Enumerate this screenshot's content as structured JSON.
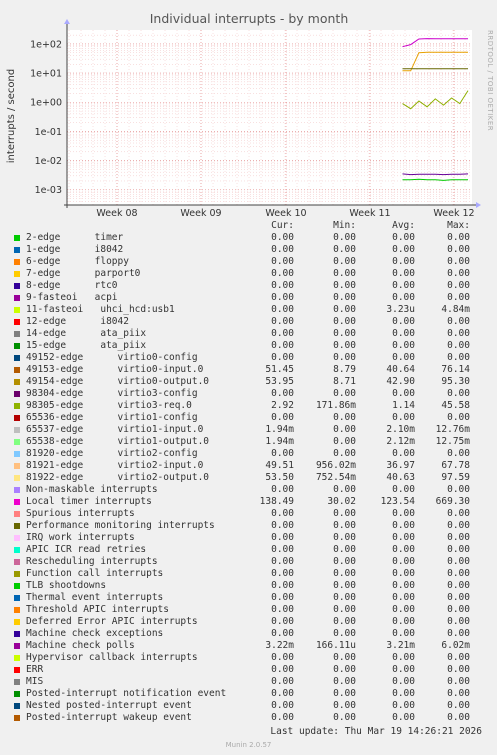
{
  "chart_data": {
    "type": "line",
    "title": "Individual interrupts - by month",
    "ylabel": "interrupts / second",
    "yscale": "log",
    "ylim": [
      0.0003,
      300
    ],
    "yticks": [
      {
        "value": 100,
        "label": "1e+02"
      },
      {
        "value": 10,
        "label": "1e+01"
      },
      {
        "value": 1,
        "label": "1e+00"
      },
      {
        "value": 0.1,
        "label": "1e-01"
      },
      {
        "value": 0.01,
        "label": "1e-02"
      },
      {
        "value": 0.001,
        "label": "1e-03"
      }
    ],
    "xticks": [
      "Week 08",
      "Week 09",
      "Week 10",
      "Week 11",
      "Week 12"
    ],
    "series": [
      {
        "color": "#cc00cc",
        "values": [
          0,
          0,
          0,
          80,
          95,
          148,
          152,
          150,
          150,
          150,
          150,
          151
        ]
      },
      {
        "color": "#e8a000",
        "values": [
          0,
          0,
          0,
          12,
          12,
          50,
          52,
          52,
          52,
          52,
          52,
          52
        ]
      },
      {
        "color": "#666600",
        "values": [
          0,
          0,
          0,
          14,
          14,
          14,
          14,
          14,
          14,
          14,
          14,
          14
        ]
      },
      {
        "color": "#8fb000",
        "values": [
          0,
          0,
          0,
          0.9,
          0.6,
          1.1,
          0.7,
          1.3,
          0.8,
          1.4,
          0.9,
          2.5
        ]
      },
      {
        "color": "#660099",
        "values": [
          0,
          0,
          0,
          0.0035,
          0.0033,
          0.0034,
          0.0034,
          0.0034,
          0.0033,
          0.0034,
          0.0034,
          0.0035
        ]
      },
      {
        "color": "#00cc00",
        "values": [
          0,
          0,
          0,
          0.0022,
          0.0022,
          0.0023,
          0.0022,
          0.0022,
          0.0021,
          0.0022,
          0.0022,
          0.0022
        ]
      }
    ]
  },
  "legend": {
    "headers": {
      "cur": "Cur:",
      "min": "Min:",
      "avg": "Avg:",
      "max": "Max:"
    },
    "rows": [
      {
        "label": "2-edge      timer",
        "color": "#00cc00",
        "cur": "0.00",
        "min": "0.00",
        "avg": "0.00",
        "max": "0.00"
      },
      {
        "label": "1-edge      i8042",
        "color": "#0066b3",
        "cur": "0.00",
        "min": "0.00",
        "avg": "0.00",
        "max": "0.00"
      },
      {
        "label": "6-edge      floppy",
        "color": "#ff8000",
        "cur": "0.00",
        "min": "0.00",
        "avg": "0.00",
        "max": "0.00"
      },
      {
        "label": "7-edge      parport0",
        "color": "#ffcc00",
        "cur": "0.00",
        "min": "0.00",
        "avg": "0.00",
        "max": "0.00"
      },
      {
        "label": "8-edge      rtc0",
        "color": "#330099",
        "cur": "0.00",
        "min": "0.00",
        "avg": "0.00",
        "max": "0.00"
      },
      {
        "label": "9-fasteoi   acpi",
        "color": "#990099",
        "cur": "0.00",
        "min": "0.00",
        "avg": "0.00",
        "max": "0.00"
      },
      {
        "label": "11-fasteoi   uhci_hcd:usb1",
        "color": "#ccff00",
        "cur": "0.00",
        "min": "0.00",
        "avg": "3.23u",
        "max": "4.84m"
      },
      {
        "label": "12-edge      i8042",
        "color": "#ff0000",
        "cur": "0.00",
        "min": "0.00",
        "avg": "0.00",
        "max": "0.00"
      },
      {
        "label": "14-edge      ata_piix",
        "color": "#808080",
        "cur": "0.00",
        "min": "0.00",
        "avg": "0.00",
        "max": "0.00"
      },
      {
        "label": "15-edge      ata_piix",
        "color": "#008f00",
        "cur": "0.00",
        "min": "0.00",
        "avg": "0.00",
        "max": "0.00"
      },
      {
        "label": "49152-edge      virtio0-config",
        "color": "#00487d",
        "cur": "0.00",
        "min": "0.00",
        "avg": "0.00",
        "max": "0.00"
      },
      {
        "label": "49153-edge      virtio0-input.0",
        "color": "#b35a00",
        "cur": "51.45",
        "min": "8.79",
        "avg": "40.64",
        "max": "76.14"
      },
      {
        "label": "49154-edge      virtio0-output.0",
        "color": "#b38f00",
        "cur": "53.95",
        "min": "8.71",
        "avg": "42.90",
        "max": "95.30"
      },
      {
        "label": "98304-edge      virtio3-config",
        "color": "#6b006b",
        "cur": "0.00",
        "min": "0.00",
        "avg": "0.00",
        "max": "0.00"
      },
      {
        "label": "98305-edge      virtio3-req.0",
        "color": "#8fb300",
        "cur": "2.92",
        "min": "171.86m",
        "avg": "1.14",
        "max": "45.58"
      },
      {
        "label": "65536-edge      virtio1-config",
        "color": "#b30000",
        "cur": "0.00",
        "min": "0.00",
        "avg": "0.00",
        "max": "0.00"
      },
      {
        "label": "65537-edge      virtio1-input.0",
        "color": "#bebebe",
        "cur": "1.94m",
        "min": "0.00",
        "avg": "2.10m",
        "max": "12.76m"
      },
      {
        "label": "65538-edge      virtio1-output.0",
        "color": "#80ff80",
        "cur": "1.94m",
        "min": "0.00",
        "avg": "2.12m",
        "max": "12.75m"
      },
      {
        "label": "81920-edge      virtio2-config",
        "color": "#80c9ff",
        "cur": "0.00",
        "min": "0.00",
        "avg": "0.00",
        "max": "0.00"
      },
      {
        "label": "81921-edge      virtio2-input.0",
        "color": "#ffc080",
        "cur": "49.51",
        "min": "956.02m",
        "avg": "36.97",
        "max": "67.78"
      },
      {
        "label": "81922-edge      virtio2-output.0",
        "color": "#ffe680",
        "cur": "53.50",
        "min": "752.54m",
        "avg": "40.63",
        "max": "97.59"
      },
      {
        "label": "Non-maskable interrupts",
        "color": "#aa80ff",
        "cur": "0.00",
        "min": "0.00",
        "avg": "0.00",
        "max": "0.00"
      },
      {
        "label": "Local timer interrupts",
        "color": "#ee00cc",
        "cur": "138.49",
        "min": "30.02",
        "avg": "123.54",
        "max": "669.30"
      },
      {
        "label": "Spurious interrupts",
        "color": "#ff8080",
        "cur": "0.00",
        "min": "0.00",
        "avg": "0.00",
        "max": "0.00"
      },
      {
        "label": "Performance monitoring interrupts",
        "color": "#666600",
        "cur": "0.00",
        "min": "0.00",
        "avg": "0.00",
        "max": "0.00"
      },
      {
        "label": "IRQ work interrupts",
        "color": "#ffbfff",
        "cur": "0.00",
        "min": "0.00",
        "avg": "0.00",
        "max": "0.00"
      },
      {
        "label": "APIC ICR read retries",
        "color": "#00ffcc",
        "cur": "0.00",
        "min": "0.00",
        "avg": "0.00",
        "max": "0.00"
      },
      {
        "label": "Rescheduling interrupts",
        "color": "#cc6699",
        "cur": "0.00",
        "min": "0.00",
        "avg": "0.00",
        "max": "0.00"
      },
      {
        "label": "Function call interrupts",
        "color": "#999900",
        "cur": "0.00",
        "min": "0.00",
        "avg": "0.00",
        "max": "0.00"
      },
      {
        "label": "TLB shootdowns",
        "color": "#00cc00",
        "cur": "0.00",
        "min": "0.00",
        "avg": "0.00",
        "max": "0.00"
      },
      {
        "label": "Thermal event interrupts",
        "color": "#0066b3",
        "cur": "0.00",
        "min": "0.00",
        "avg": "0.00",
        "max": "0.00"
      },
      {
        "label": "Threshold APIC interrupts",
        "color": "#ff8000",
        "cur": "0.00",
        "min": "0.00",
        "avg": "0.00",
        "max": "0.00"
      },
      {
        "label": "Deferred Error APIC interrupts",
        "color": "#ffcc00",
        "cur": "0.00",
        "min": "0.00",
        "avg": "0.00",
        "max": "0.00"
      },
      {
        "label": "Machine check exceptions",
        "color": "#330099",
        "cur": "0.00",
        "min": "0.00",
        "avg": "0.00",
        "max": "0.00"
      },
      {
        "label": "Machine check polls",
        "color": "#990099",
        "cur": "3.22m",
        "min": "166.11u",
        "avg": "3.21m",
        "max": "6.02m"
      },
      {
        "label": "Hypervisor callback interrupts",
        "color": "#ccff00",
        "cur": "0.00",
        "min": "0.00",
        "avg": "0.00",
        "max": "0.00"
      },
      {
        "label": "ERR",
        "color": "#ff0000",
        "cur": "0.00",
        "min": "0.00",
        "avg": "0.00",
        "max": "0.00"
      },
      {
        "label": "MIS",
        "color": "#808080",
        "cur": "0.00",
        "min": "0.00",
        "avg": "0.00",
        "max": "0.00"
      },
      {
        "label": "Posted-interrupt notification event",
        "color": "#008f00",
        "cur": "0.00",
        "min": "0.00",
        "avg": "0.00",
        "max": "0.00"
      },
      {
        "label": "Nested posted-interrupt event",
        "color": "#00487d",
        "cur": "0.00",
        "min": "0.00",
        "avg": "0.00",
        "max": "0.00"
      },
      {
        "label": "Posted-interrupt wakeup event",
        "color": "#b35a00",
        "cur": "0.00",
        "min": "0.00",
        "avg": "0.00",
        "max": "0.00"
      }
    ]
  },
  "footer": {
    "last_update": "Last update: Thu Mar 19 14:26:21 2026",
    "munin": "Munin 2.0.57",
    "side_text": "RRDTOOL / TOBI OETIKER"
  }
}
